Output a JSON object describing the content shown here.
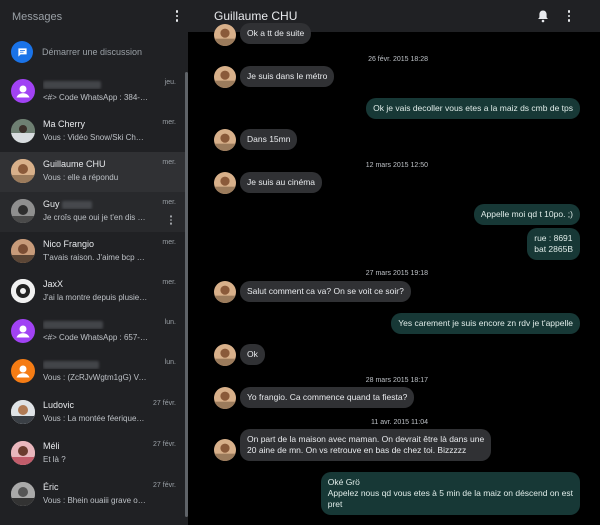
{
  "app": {
    "title": "Messages"
  },
  "new_conversation": {
    "label": "Démarrer une discussion"
  },
  "conversations": [
    {
      "name": "",
      "snippet": "<#> Code WhatsApp : 384-4…",
      "date": "jeu."
    },
    {
      "name": "Ma Cherry",
      "snippet": "Vous : Vidéo Snow/Ski Cha…",
      "date": "mer."
    },
    {
      "name": "Guillaume CHU",
      "snippet": "Vous : elle a répondu",
      "date": "mer."
    },
    {
      "name": "Guy",
      "snippet": "Je croîs que oui je t'en dis pl…",
      "date": "mer."
    },
    {
      "name": "Nico Frangio",
      "snippet": "T'avais raison. J'aime bcp O…",
      "date": "mer."
    },
    {
      "name": "JaxX",
      "snippet": "J'ai la montre depuis plusieu…",
      "date": "mer."
    },
    {
      "name": "",
      "snippet": "<#> Code WhatsApp : 657-1…",
      "date": "lun."
    },
    {
      "name": "",
      "snippet": "Vous : (ZcRJvWgtm1gG) Vali…",
      "date": "lun."
    },
    {
      "name": "Ludovic",
      "snippet": "Vous : La montée féerique…",
      "date": "27 févr."
    },
    {
      "name": "Méli",
      "snippet": "Et là ?",
      "date": "27 févr."
    },
    {
      "name": "Éric",
      "snippet": "Vous : Bhein ouaiii grave on…",
      "date": "27 févr."
    }
  ],
  "thread": {
    "contact_name": "Guillaume CHU",
    "timestamps": [
      "26 févr. 2015 18:28",
      "12 mars 2015 12:50",
      "27 mars 2015 19:18",
      "28 mars 2015 18:17",
      "11 avr. 2015 11:04"
    ],
    "messages": [
      {
        "dir": "in",
        "text": "Ok a tt de suite"
      },
      {
        "dir": "in",
        "text": "Je suis dans le métro"
      },
      {
        "dir": "out",
        "text": "Ok je vais decoller vous etes a la maiz ds cmb de tps"
      },
      {
        "dir": "in",
        "text": "Dans 15mn"
      },
      {
        "dir": "in",
        "text": "Je suis au cinéma"
      },
      {
        "dir": "out",
        "text": "Appelle moi qd t 10po. ;)"
      },
      {
        "dir": "out",
        "lines": [
          "rue : 8691",
          "bat 2865B"
        ]
      },
      {
        "dir": "in",
        "text": "Salut comment ca va? On se voit ce soir?"
      },
      {
        "dir": "out",
        "text": "Yes carement je suis encore zn rdv je t'appelle"
      },
      {
        "dir": "in",
        "text": "Ok"
      },
      {
        "dir": "in",
        "text": "Yo frangio. Ca commence quand ta fiesta?"
      },
      {
        "dir": "in",
        "lines": [
          "On part de la maison avec maman. On devrait être là dans une",
          "20 aine de mn. On vs retrouve en bas de chez toi. Bizzzzz"
        ]
      },
      {
        "dir": "out",
        "lines": [
          "Oké Grö",
          "Appelez nous qd vous etes à 5 min de la maiz on déscend on est",
          "pret"
        ]
      }
    ]
  },
  "colors": {
    "accent": "#1a73e8",
    "outgoing_bubble": "#173836",
    "incoming_bubble": "#303134",
    "sidebar": "#202124"
  },
  "icons": {
    "new_conversation": "chat-bubble-icon",
    "notifications": "bell-icon",
    "menu": "more-vert-icon"
  }
}
